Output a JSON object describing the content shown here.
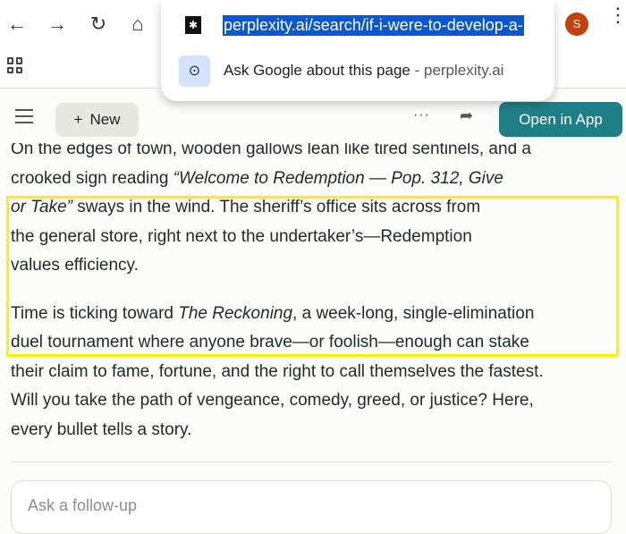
{
  "browser": {
    "url": "perplexity.ai/search/if-i-were-to-develop-a-",
    "suggestion_text": "Ask Google about this page",
    "suggestion_separator": " - ",
    "suggestion_domain": "perplexity.ai",
    "avatar_letter": "S"
  },
  "header": {
    "new_label": "New",
    "open_app_label": "Open in App"
  },
  "content": {
    "p1": [
      [
        {
          "t": "On the edges of town, wooden gallows lean like tired sentinels, and a",
          "i": false
        }
      ],
      [
        {
          "t": "crooked sign reading ",
          "i": false
        },
        {
          "t": "“Welcome to Redemption — Pop. 312, Give",
          "i": true
        }
      ],
      [
        {
          "t": "or Take”",
          "i": true
        },
        {
          "t": " sways in the wind. The sheriff’s office sits across from",
          "i": false
        }
      ],
      [
        {
          "t": "the general store, right next to the undertaker’s—Redemption",
          "i": false
        }
      ],
      [
        {
          "t": "values efficiency.",
          "i": false
        }
      ]
    ],
    "p2": [
      [
        {
          "t": "Time is ticking toward ",
          "i": false
        },
        {
          "t": "The Reckoning",
          "i": true
        },
        {
          "t": ", a week-long, single-elimination",
          "i": false
        }
      ],
      [
        {
          "t": "duel tournament where anyone brave—or foolish—enough can stake",
          "i": false
        }
      ],
      [
        {
          "t": "their claim to fame, fortune, and the right to call themselves the fastest.",
          "i": false
        }
      ],
      [
        {
          "t": "Will you take the path of vengeance, comedy, greed, or justice? Here,",
          "i": false
        }
      ],
      [
        {
          "t": "every bullet tells a story.",
          "i": false
        }
      ]
    ]
  },
  "followup": {
    "placeholder": "Ask a follow-up"
  },
  "colors": {
    "accent": "#1f7f86",
    "highlight": "#fff200",
    "url_selection": "#0b57d0"
  }
}
